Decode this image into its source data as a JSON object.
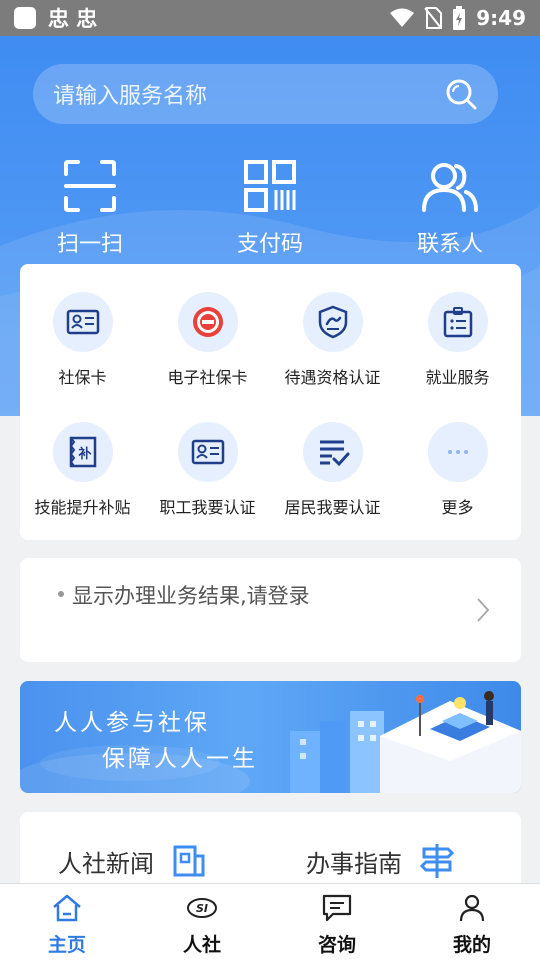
{
  "status_bar": {
    "app_icons": "忠 忠",
    "time": "9:49"
  },
  "search": {
    "placeholder": "请输入服务名称"
  },
  "quick_actions": [
    {
      "label": "扫一扫",
      "icon": "scan-icon"
    },
    {
      "label": "支付码",
      "icon": "qr-code-icon"
    },
    {
      "label": "联系人",
      "icon": "contacts-icon"
    }
  ],
  "services": [
    {
      "label": "社保卡",
      "icon": "id-card-icon"
    },
    {
      "label": "电子社保卡",
      "icon": "e-social-card-icon"
    },
    {
      "label": "待遇资格认证",
      "icon": "shield-check-icon"
    },
    {
      "label": "就业服务",
      "icon": "badge-icon"
    },
    {
      "label": "技能提升补贴",
      "icon": "subsidy-icon"
    },
    {
      "label": "职工我要认证",
      "icon": "worker-card-icon"
    },
    {
      "label": "居民我要认证",
      "icon": "checklist-icon"
    },
    {
      "label": "更多",
      "icon": "more-icon"
    }
  ],
  "login_prompt": "显示办理业务结果,请登录",
  "banner": {
    "line1": "人人参与社保",
    "line2": "保障人人一生"
  },
  "news": [
    {
      "label": "人社新闻",
      "icon": "news-icon"
    },
    {
      "label": "办事指南",
      "icon": "signpost-icon"
    }
  ],
  "bottom_nav": [
    {
      "label": "主页",
      "icon": "home-icon",
      "active": true
    },
    {
      "label": "人社",
      "icon": "si-logo-icon",
      "active": false
    },
    {
      "label": "咨询",
      "icon": "chat-icon",
      "active": false
    },
    {
      "label": "我的",
      "icon": "user-icon",
      "active": false
    }
  ],
  "colors": {
    "primary": "#3f8cf2",
    "active_nav": "#2f7be5",
    "icon_blue": "#1e5bd6"
  }
}
